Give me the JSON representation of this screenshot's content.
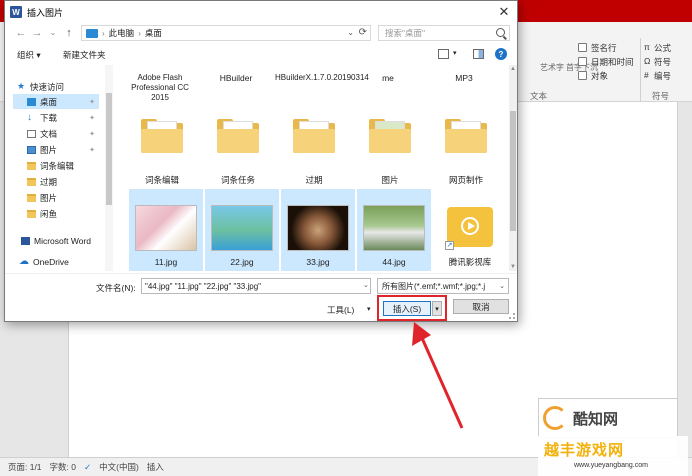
{
  "word": {
    "ribbon_right": {
      "col1": [
        "签名行",
        "日期和时间",
        "对象"
      ],
      "col2": [
        "公式",
        "符号",
        "编号"
      ],
      "partial_labels": [
        "艺术字",
        "首字下沉"
      ],
      "group_text": "文本",
      "group_symbol": "符号"
    },
    "status": {
      "page": "页面: 1/1",
      "words": "字数: 0",
      "language": "中文(中国)",
      "mode": "插入"
    }
  },
  "dialog": {
    "title": "插入图片",
    "breadcrumb": [
      "此电脑",
      "桌面"
    ],
    "search_placeholder": "搜索\"桌面\"",
    "toolbar": {
      "organize": "组织 ▾",
      "new_folder": "新建文件夹"
    },
    "sidebar": [
      {
        "label": "快速访问",
        "icon": "star-icon"
      },
      {
        "label": "桌面",
        "icon": "desktop-icon",
        "pinned": true,
        "selected": true
      },
      {
        "label": "下载",
        "icon": "download-icon",
        "pinned": true
      },
      {
        "label": "文档",
        "icon": "document-icon",
        "pinned": true
      },
      {
        "label": "图片",
        "icon": "picture-icon",
        "pinned": true
      },
      {
        "label": "词条编辑",
        "icon": "folder-icon"
      },
      {
        "label": "过期",
        "icon": "folder-icon"
      },
      {
        "label": "图片",
        "icon": "folder-icon"
      },
      {
        "label": "闲鱼",
        "icon": "folder-icon"
      },
      {
        "label": "Microsoft Word",
        "icon": "word-icon"
      },
      {
        "label": "OneDrive",
        "icon": "onedrive-icon"
      }
    ],
    "files_row1": [
      "Adobe Flash Professional CC 2015",
      "HBuilder",
      "HBuilderX.1.7.0.20190314",
      "me",
      "MP3"
    ],
    "files_row2": [
      "词条编辑",
      "词条任务",
      "过期",
      "图片",
      "网页制作"
    ],
    "files_row3": [
      "11.jpg",
      "22.jpg",
      "33.jpg",
      "44.jpg",
      "腾讯影视库"
    ],
    "filename_label": "文件名(N):",
    "filename_value": "\"44.jpg\" \"11.jpg\" \"22.jpg\" \"33.jpg\"",
    "filter_value": "所有图片(*.emf;*.wmf;*.jpg;*.j",
    "tools_label": "工具(L)",
    "insert_label": "插入(S)",
    "cancel_label": "取消"
  },
  "watermark": {
    "logo_text": "酷知网",
    "site_text": "越丰游戏网",
    "url": "www.yueyangbang.com"
  },
  "colors": {
    "annotation": "#e0242c",
    "selection": "#cce8ff",
    "word_red": "#c00000"
  }
}
